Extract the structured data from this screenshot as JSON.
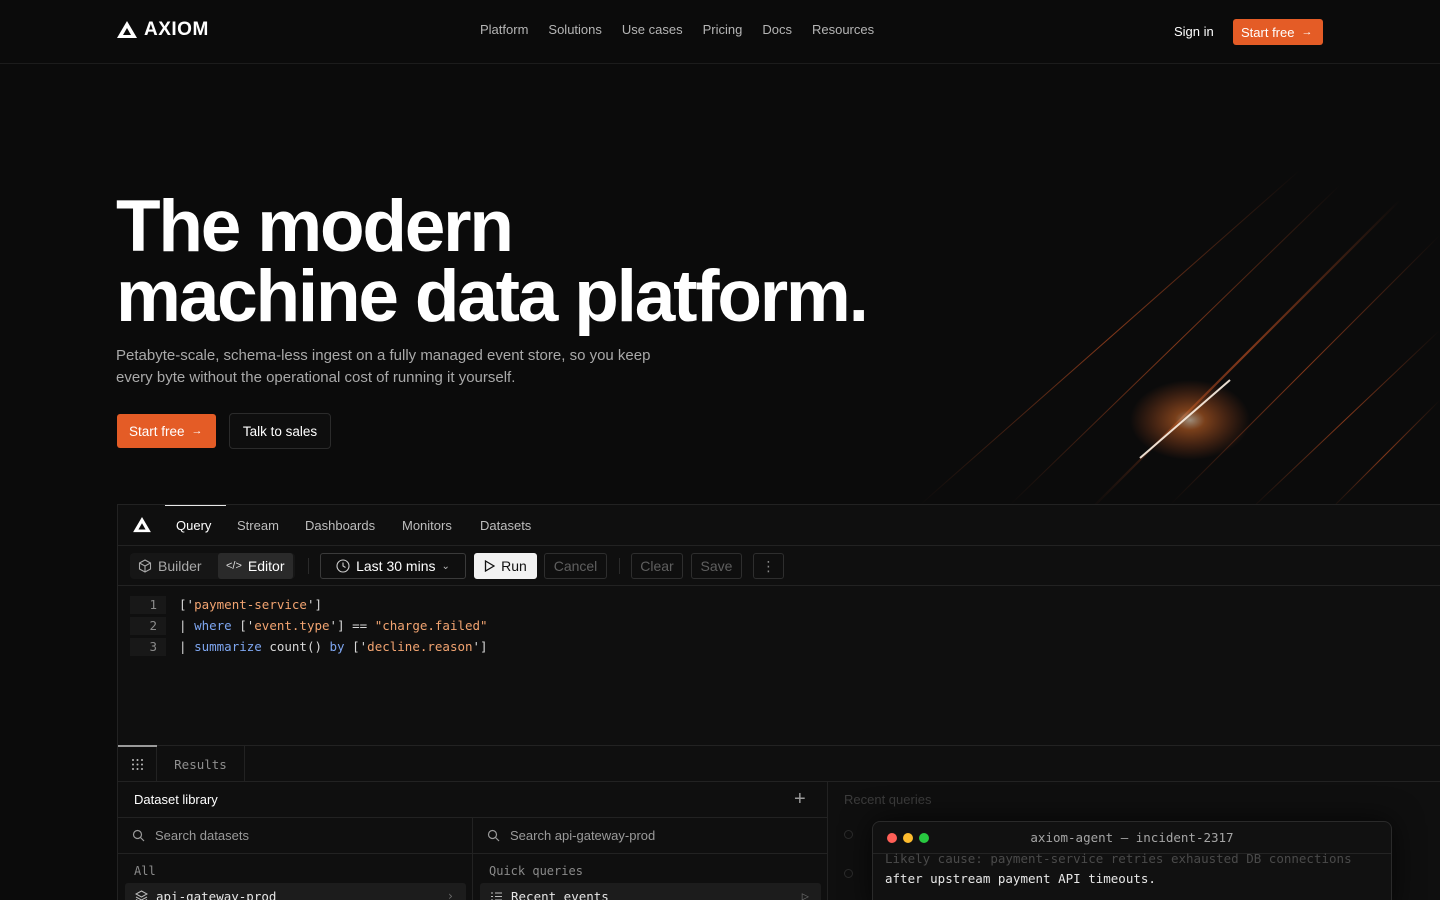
{
  "nav": {
    "brand": "AXIOM",
    "links": [
      "Platform",
      "Solutions",
      "Use cases",
      "Pricing",
      "Docs",
      "Resources"
    ],
    "sign_in": "Sign in",
    "cta": "Start free"
  },
  "hero": {
    "title_line1": "The modern",
    "title_line2": "machine data platform.",
    "subtitle": "Petabyte-scale, schema-less ingest on a fully managed event store, so you keep every byte without the operational cost of running it yourself.",
    "primary_cta": "Start free",
    "secondary_cta": "Talk to sales"
  },
  "app": {
    "tabs": [
      "Query",
      "Stream",
      "Dashboards",
      "Monitors",
      "Datasets"
    ],
    "active_tab": "Query",
    "toolbar": {
      "builder": "Builder",
      "editor": "Editor",
      "time_range": "Last 30 mins",
      "run": "Run",
      "cancel": "Cancel",
      "clear": "Clear",
      "save": "Save"
    },
    "code": {
      "line_numbers": [
        "1",
        "2",
        "3"
      ],
      "l1_open": "['",
      "l1_str": "payment-service",
      "l1_close": "']",
      "l2_pipe": "| ",
      "l2_kw": "where",
      "l2_open": " ['",
      "l2_str": "event.type",
      "l2_mid": "'] == ",
      "l2_val": "\"charge.failed\"",
      "l3_pipe": "| ",
      "l3_kw": "summarize",
      "l3_fn": " count() ",
      "l3_by": "by",
      "l3_open": " ['",
      "l3_str": "decline.reason",
      "l3_close": "']"
    },
    "results_label": "Results",
    "library": {
      "title": "Dataset library",
      "recent_label": "Recent queries",
      "search_datasets": "Search datasets",
      "search_dataset": "Search api-gateway-prod",
      "all_label": "All",
      "quick_label": "Quick queries",
      "dataset_item": "api-gateway-prod",
      "quick_item": "Recent events"
    }
  },
  "agent": {
    "title": "axiom-agent — incident-2317",
    "faded_line": "Likely cause: payment-service retries exhausted DB connections",
    "line": "after upstream payment API timeouts."
  },
  "colors": {
    "accent": "#e45c26",
    "background": "#0b0b0b",
    "string": "#f2a471",
    "keyword": "#7ea6f0"
  }
}
